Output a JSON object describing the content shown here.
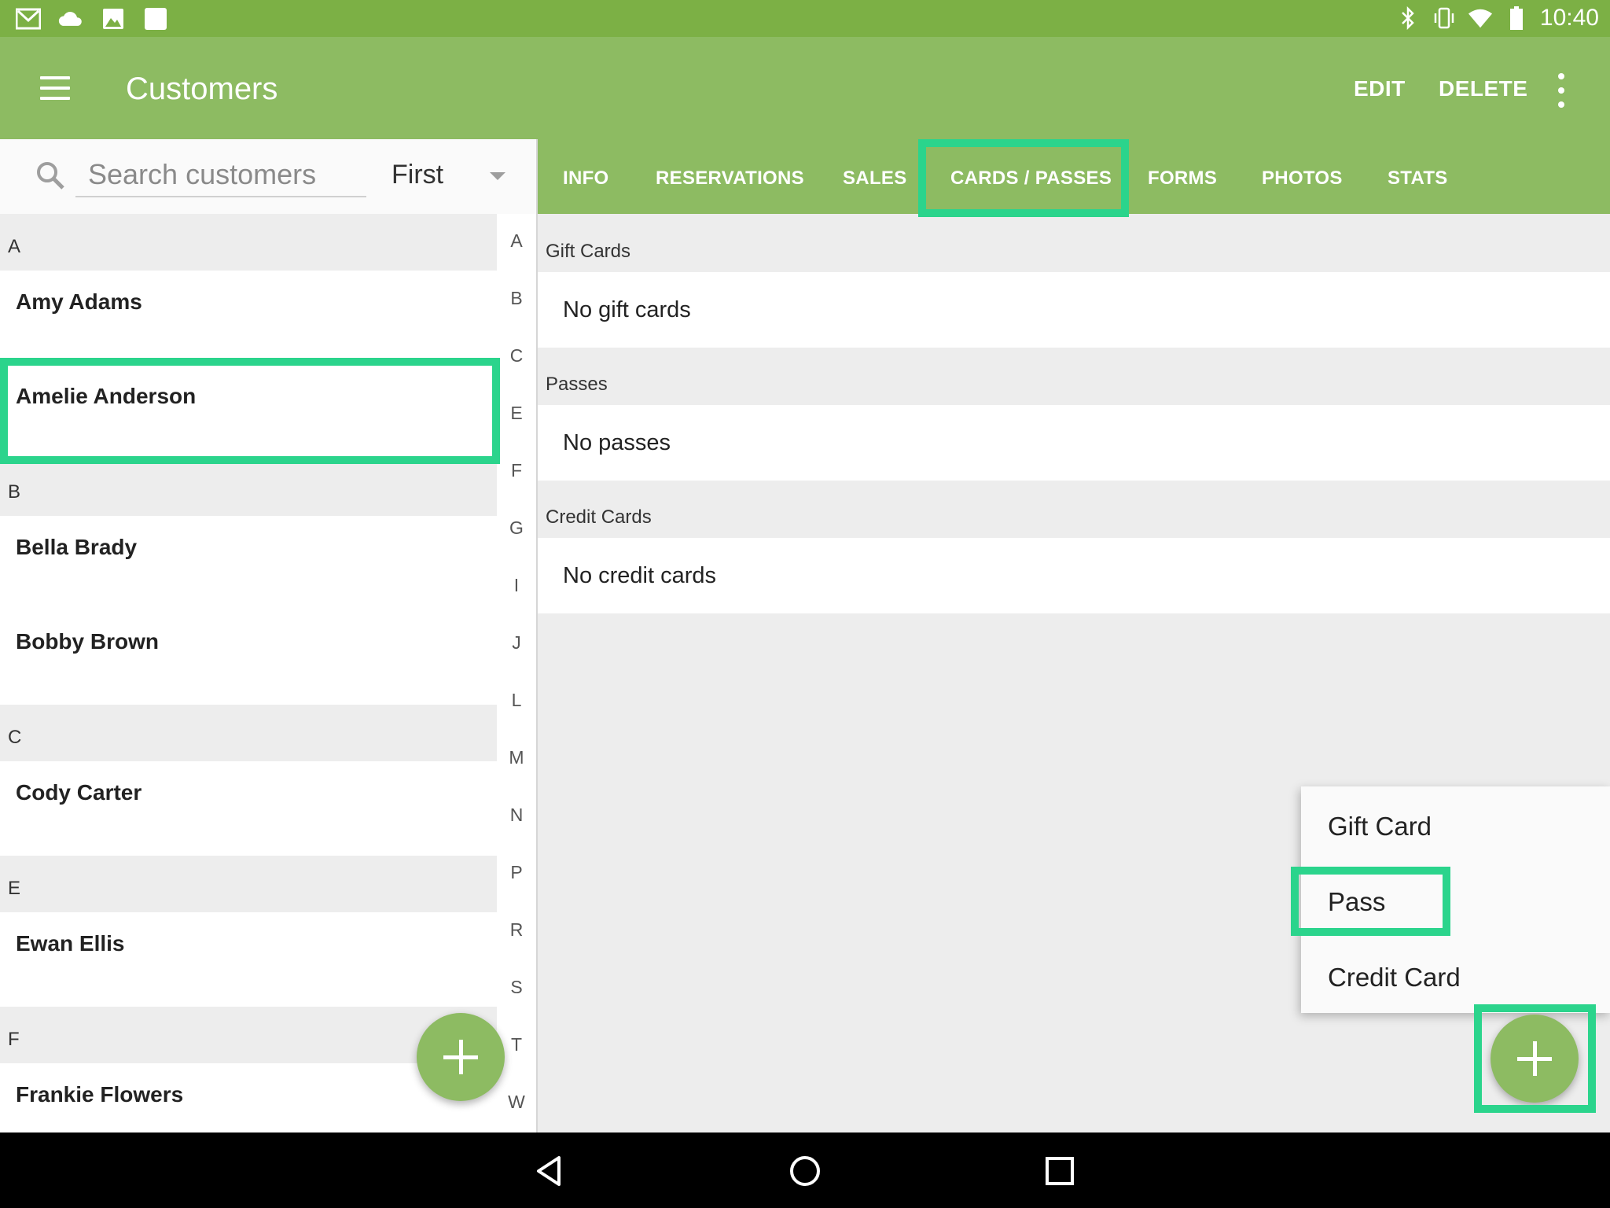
{
  "status_bar": {
    "time": "10:40",
    "left_icons": [
      "gmail-icon",
      "cloud-icon",
      "image-icon",
      "square-icon"
    ],
    "right_icons": [
      "bluetooth-icon",
      "vibrate-icon",
      "wifi-icon",
      "battery-icon"
    ]
  },
  "app_bar": {
    "title": "Customers",
    "edit_label": "EDIT",
    "delete_label": "DELETE"
  },
  "search": {
    "placeholder": "Search customers",
    "sort_value": "First"
  },
  "customers": [
    {
      "letter": "A",
      "names": [
        "Amy Adams",
        "Amelie Anderson"
      ]
    },
    {
      "letter": "B",
      "names": [
        "Bella Brady",
        "Bobby Brown"
      ]
    },
    {
      "letter": "C",
      "names": [
        "Cody Carter"
      ]
    },
    {
      "letter": "E",
      "names": [
        "Ewan Ellis"
      ]
    },
    {
      "letter": "F",
      "names": [
        "Frankie Flowers"
      ]
    }
  ],
  "alpha_index": [
    "A",
    "B",
    "C",
    "E",
    "F",
    "G",
    "I",
    "J",
    "L",
    "M",
    "N",
    "P",
    "R",
    "S",
    "T",
    "W"
  ],
  "tabs": [
    "INFO",
    "RESERVATIONS",
    "SALES",
    "CARDS / PASSES",
    "FORMS",
    "PHOTOS",
    "STATS"
  ],
  "selected_tab": "CARDS / PASSES",
  "cards_passes": {
    "gift_cards_header": "Gift Cards",
    "gift_cards_empty": "No gift cards",
    "passes_header": "Passes",
    "passes_empty": "No passes",
    "credit_cards_header": "Credit Cards",
    "credit_cards_empty": "No credit cards"
  },
  "add_menu": [
    "Gift Card",
    "Pass",
    "Credit Card"
  ],
  "colors": {
    "status_bar": "#7cb045",
    "primary": "#8dbb62",
    "highlight": "#2bd48c",
    "background": "#ededed"
  }
}
